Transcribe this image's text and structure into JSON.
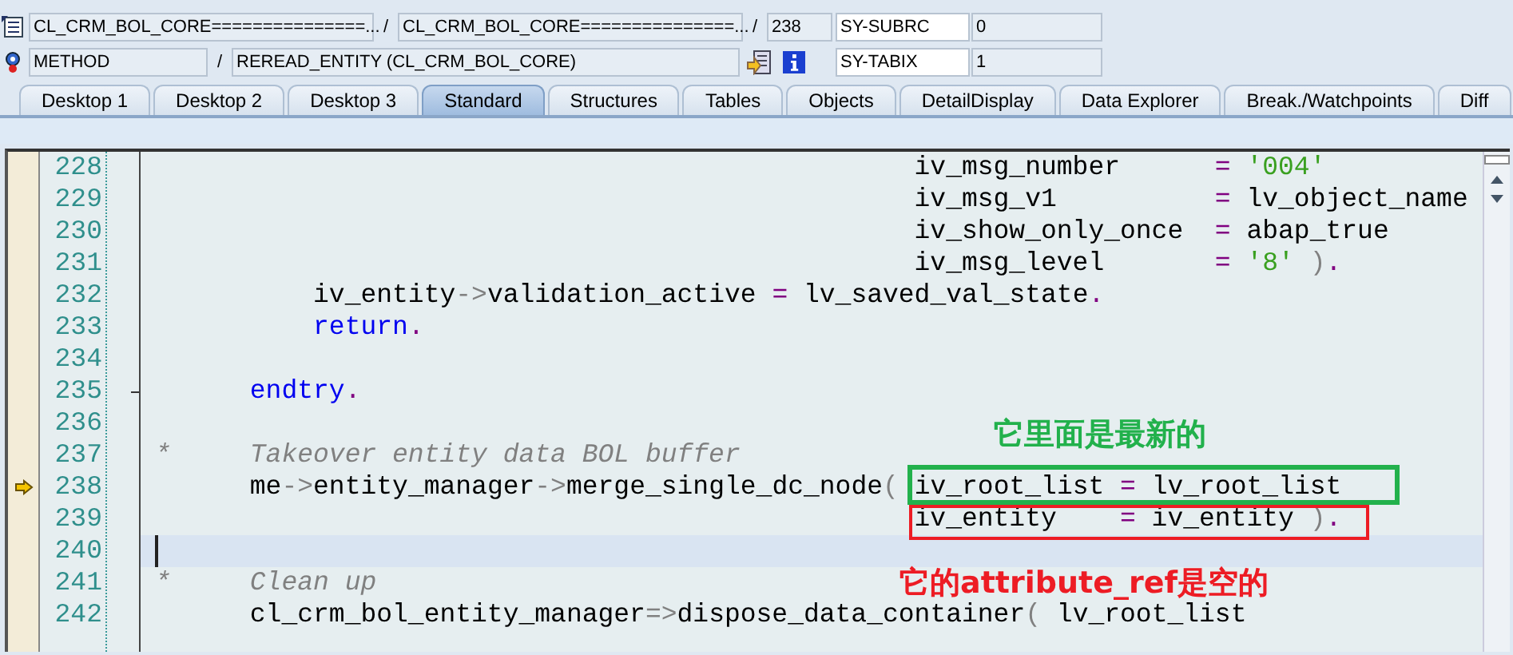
{
  "header": {
    "rows": [
      {
        "items": [
          {
            "kind": "field",
            "text": "CL_CRM_BOL_CORE===============..."
          },
          {
            "kind": "separator",
            "text": "/"
          },
          {
            "kind": "field",
            "text": "CL_CRM_BOL_CORE===============..."
          },
          {
            "kind": "separator",
            "text": "/"
          },
          {
            "kind": "field",
            "text": "238"
          }
        ],
        "sys_name": "SY-SUBRC",
        "sys_value": "0"
      },
      {
        "items": [
          {
            "kind": "field",
            "text": "METHOD"
          },
          {
            "kind": "separator",
            "text": "/"
          },
          {
            "kind": "field",
            "text": "REREAD_ENTITY (CL_CRM_BOL_CORE)"
          }
        ],
        "sys_name": "SY-TABIX",
        "sys_value": "1"
      }
    ]
  },
  "tabs": [
    {
      "label": "Desktop 1",
      "selected": false
    },
    {
      "label": "Desktop 2",
      "selected": false
    },
    {
      "label": "Desktop 3",
      "selected": false
    },
    {
      "label": "Standard",
      "selected": true
    },
    {
      "label": "Structures",
      "selected": false
    },
    {
      "label": "Tables",
      "selected": false
    },
    {
      "label": "Objects",
      "selected": false
    },
    {
      "label": "DetailDisplay",
      "selected": false
    },
    {
      "label": "Data Explorer",
      "selected": false
    },
    {
      "label": "Break./Watchpoints",
      "selected": false
    },
    {
      "label": "Diff",
      "selected": false
    }
  ],
  "editor": {
    "lines": [
      {
        "number": "228",
        "executing": false,
        "cursor": false,
        "fold": false,
        "segments": [
          {
            "kind": "text",
            "text": "                                                iv_msg_number      "
          },
          {
            "kind": "op",
            "text": "="
          },
          {
            "kind": "literal",
            "text": " '004'"
          }
        ]
      },
      {
        "number": "229",
        "executing": false,
        "cursor": false,
        "fold": false,
        "segments": [
          {
            "kind": "text",
            "text": "                                                iv_msg_v1          "
          },
          {
            "kind": "op",
            "text": "="
          },
          {
            "kind": "text",
            "text": " lv_object_name"
          }
        ]
      },
      {
        "number": "230",
        "executing": false,
        "cursor": false,
        "fold": false,
        "segments": [
          {
            "kind": "text",
            "text": "                                                iv_show_only_once  "
          },
          {
            "kind": "op",
            "text": "="
          },
          {
            "kind": "text",
            "text": " abap_true"
          }
        ]
      },
      {
        "number": "231",
        "executing": false,
        "cursor": false,
        "fold": false,
        "segments": [
          {
            "kind": "text",
            "text": "                                                iv_msg_level       "
          },
          {
            "kind": "op",
            "text": "="
          },
          {
            "kind": "literal",
            "text": " '8'"
          },
          {
            "kind": "arrow",
            "text": " )"
          },
          {
            "kind": "op",
            "text": "."
          }
        ]
      },
      {
        "number": "232",
        "executing": false,
        "cursor": false,
        "fold": false,
        "segments": [
          {
            "kind": "text",
            "text": "          iv_entity"
          },
          {
            "kind": "arrow",
            "text": "->"
          },
          {
            "kind": "text",
            "text": "validation_active "
          },
          {
            "kind": "op",
            "text": "="
          },
          {
            "kind": "text",
            "text": " lv_saved_val_state"
          },
          {
            "kind": "op",
            "text": "."
          }
        ]
      },
      {
        "number": "233",
        "executing": false,
        "cursor": false,
        "fold": false,
        "segments": [
          {
            "kind": "keyword",
            "text": "          return"
          },
          {
            "kind": "op",
            "text": "."
          }
        ]
      },
      {
        "number": "234",
        "executing": false,
        "cursor": false,
        "fold": false
      },
      {
        "number": "235",
        "executing": false,
        "cursor": false,
        "fold": true,
        "segments": [
          {
            "kind": "keyword",
            "text": "      endtry"
          },
          {
            "kind": "op",
            "text": "."
          }
        ]
      },
      {
        "number": "236",
        "executing": false,
        "cursor": false,
        "fold": false
      },
      {
        "number": "237",
        "executing": false,
        "cursor": false,
        "fold": false,
        "segments": [
          {
            "kind": "comment",
            "text": "*     Takeover entity data BOL buffer"
          }
        ]
      },
      {
        "number": "238",
        "executing": true,
        "cursor": false,
        "fold": false,
        "segments": [
          {
            "kind": "text",
            "text": "      me"
          },
          {
            "kind": "arrow",
            "text": "->"
          },
          {
            "kind": "text",
            "text": "entity_manager"
          },
          {
            "kind": "arrow",
            "text": "->"
          },
          {
            "kind": "text",
            "text": "merge_single_dc_node"
          },
          {
            "kind": "arrow",
            "text": "("
          },
          {
            "kind": "text",
            "text": " iv_root_list "
          },
          {
            "kind": "op",
            "text": "="
          },
          {
            "kind": "text",
            "text": " lv_root_list"
          }
        ]
      },
      {
        "number": "239",
        "executing": false,
        "cursor": false,
        "fold": false,
        "segments": [
          {
            "kind": "text",
            "text": "                                                iv_entity    "
          },
          {
            "kind": "op",
            "text": "="
          },
          {
            "kind": "text",
            "text": " iv_entity "
          },
          {
            "kind": "arrow",
            "text": ")"
          },
          {
            "kind": "op",
            "text": "."
          }
        ]
      },
      {
        "number": "240",
        "executing": false,
        "cursor": true,
        "fold": false
      },
      {
        "number": "241",
        "executing": false,
        "cursor": false,
        "fold": false,
        "segments": [
          {
            "kind": "comment",
            "text": "*     Clean up"
          }
        ]
      },
      {
        "number": "242",
        "executing": false,
        "cursor": false,
        "fold": false,
        "segments": [
          {
            "kind": "text",
            "text": "      cl_crm_bol_entity_manager"
          },
          {
            "kind": "arrow",
            "text": "=>"
          },
          {
            "kind": "text",
            "text": "dispose_data_container"
          },
          {
            "kind": "arrow",
            "text": "("
          },
          {
            "kind": "text",
            "text": " lv_root_list"
          }
        ]
      }
    ]
  },
  "annotations": [
    {
      "kind": "label",
      "text": "它里面是最新的",
      "color": "#22b14c"
    },
    {
      "kind": "box",
      "color": "#22b14c"
    },
    {
      "kind": "box",
      "color": "#ed1c24"
    },
    {
      "kind": "label",
      "text": "它的attribute_ref是空的",
      "color": "#ed1c24"
    }
  ]
}
